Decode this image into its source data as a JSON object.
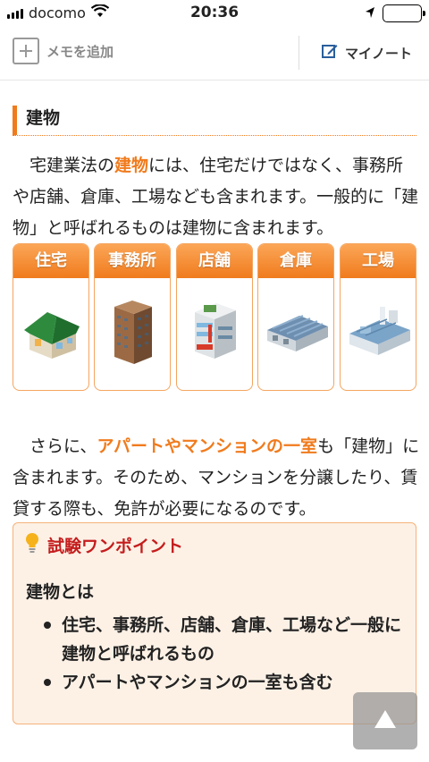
{
  "status_bar": {
    "carrier": "docomo",
    "time": "20:36"
  },
  "toolbar": {
    "add_memo_label": "メモを追加",
    "my_note_label": "マイノート"
  },
  "section": {
    "heading": "建物"
  },
  "intro": {
    "text_before": "　宅建業法の",
    "highlight": "建物",
    "text_after": "には、住宅だけではなく、事務所や店舗、倉庫、工場なども含まれます。一般的に「建物」と呼ばれるものは建物に含まれます。"
  },
  "cards": [
    {
      "label": "住宅",
      "icon": "house-icon"
    },
    {
      "label": "事務所",
      "icon": "office-building-icon"
    },
    {
      "label": "店舗",
      "icon": "store-icon"
    },
    {
      "label": "倉庫",
      "icon": "warehouse-icon"
    },
    {
      "label": "工場",
      "icon": "factory-icon"
    }
  ],
  "second": {
    "text_before": "　さらに、",
    "highlight": "アパートやマンションの一室",
    "text_after": "も「建物」に含まれます。そのため、マンションを分譲したり、賃貸する際も、免許が必要になるのです。"
  },
  "tip": {
    "title": "試験ワンポイント",
    "subtitle": "建物とは",
    "items": [
      "住宅、事務所、店舗、倉庫、工場など一般に建物と呼ばれるもの",
      "アパートやマンションの一室も含む"
    ]
  },
  "colors": {
    "accent": "#f07b1d",
    "tip_title": "#c41d1d",
    "tip_bg": "#fdf1e6"
  }
}
